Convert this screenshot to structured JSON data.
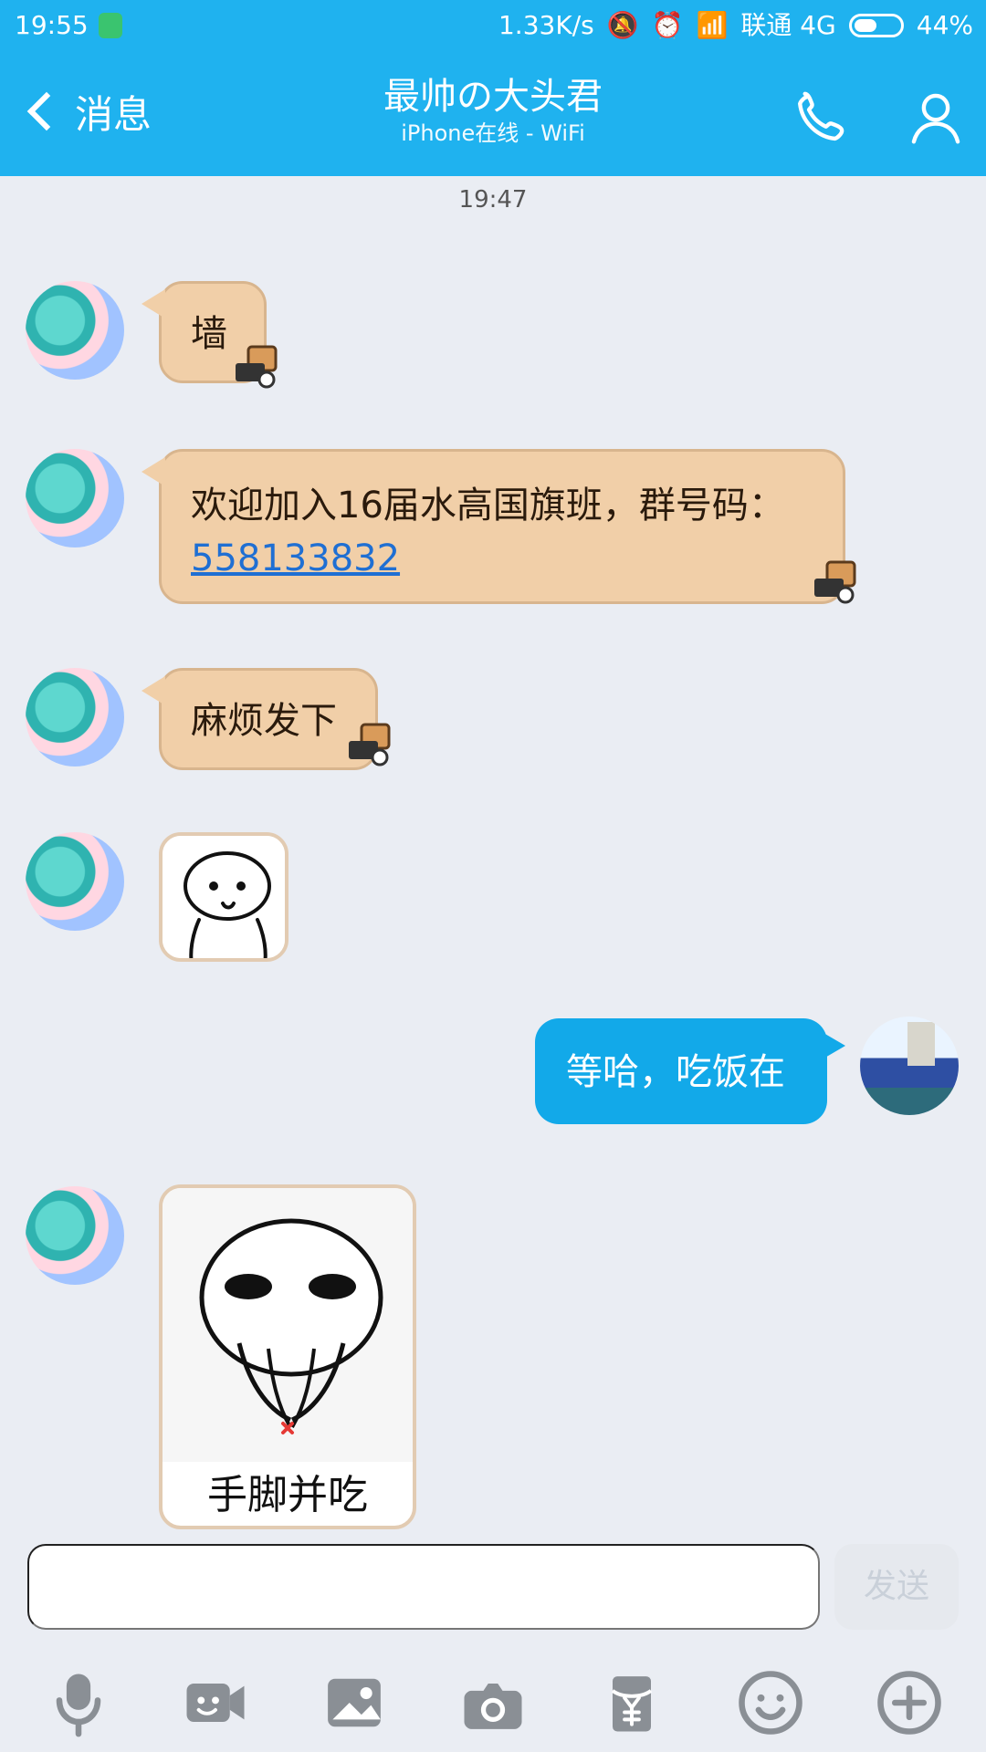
{
  "status": {
    "time": "19:55",
    "speed": "1.33K/s",
    "carrier": "联通 4G",
    "battery": "44%"
  },
  "header": {
    "back_label": "消息",
    "title": "最帅の大头君",
    "subtitle": "iPhone在线 - WiFi"
  },
  "chat": {
    "time": "19:47",
    "messages": [
      {
        "from": "other",
        "text": "墙"
      },
      {
        "from": "other",
        "text_line1": "欢迎加入16届水高国旗班，群号码：",
        "link": "558133832"
      },
      {
        "from": "other",
        "text": "麻烦发下"
      },
      {
        "from": "other",
        "sticker": "smiling-face-sticker"
      },
      {
        "from": "self",
        "text": "等哈，吃饭在"
      },
      {
        "from": "other",
        "sticker": "eating-hand-sticker",
        "caption": "手脚并吃"
      }
    ]
  },
  "input": {
    "send_label": "发送",
    "placeholder": ""
  },
  "colors": {
    "header": "#1fb2ef",
    "incoming_bubble": "#f1cfa8",
    "outgoing_bubble": "#12a9e9",
    "background": "#eaedf3"
  },
  "icons": {
    "toolbar": [
      "microphone-icon",
      "video-call-icon",
      "image-icon",
      "camera-icon",
      "red-packet-icon",
      "emoji-icon",
      "plus-icon"
    ]
  }
}
